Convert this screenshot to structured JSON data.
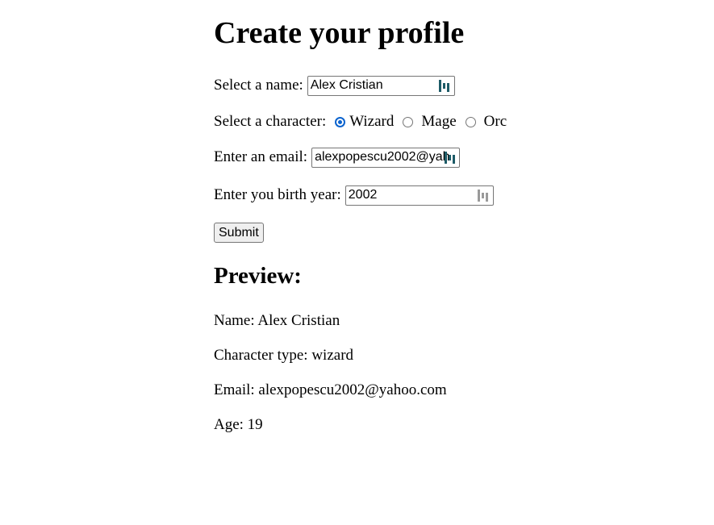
{
  "page": {
    "title": "Create your profile"
  },
  "form": {
    "name_label": "Select a name:",
    "name_value": "Alex Cristian",
    "character_label": "Select a character:",
    "character_options": [
      "Wizard",
      "Mage",
      "Orc"
    ],
    "character_selected": "Wizard",
    "email_label": "Enter an email:",
    "email_value": "alexpopescu2002@yahoo.com",
    "email_visible": "alexpopescu2002@yah",
    "birth_year_label": "Enter you birth year:",
    "birth_year_value": "2002",
    "submit_label": "Submit"
  },
  "preview": {
    "heading": "Preview:",
    "name_line": "Name: Alex Cristian",
    "character_line": "Character type: wizard",
    "email_line": "Email: alexpopescu2002@yahoo.com",
    "age_line": "Age: 19"
  },
  "icons": {
    "field_icon": "password-manager-icon"
  },
  "colors": {
    "radio_checked": "#0b63ce",
    "field_icon_active": "#1d5b67",
    "field_icon_inactive": "#9a9a9a",
    "button_bg": "#efefef"
  }
}
